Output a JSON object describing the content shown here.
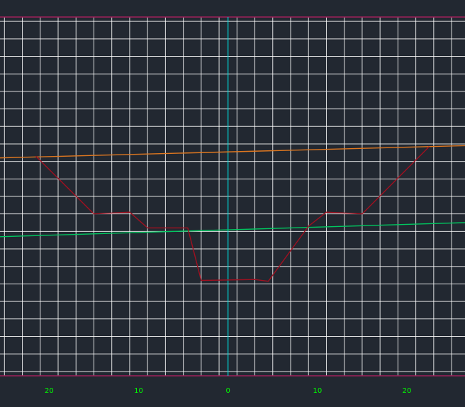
{
  "chart_data": {
    "type": "line",
    "title": "",
    "xlabel": "",
    "ylabel": "",
    "xlim": [
      -25.5,
      26.5
    ],
    "ylim": [
      -8.25,
      12.25
    ],
    "x_ticks": [
      -20,
      -10,
      0,
      10,
      20
    ],
    "x_tick_labels": [
      "20",
      "10",
      "0",
      "10",
      "20"
    ],
    "grid": true,
    "legend": "none",
    "colors": {
      "background": "#222831",
      "grid": "#FFFFFF",
      "border": "#A0205A",
      "center_axis": "#00D8D8",
      "tick_label": "#00FF00"
    },
    "series": [
      {
        "color": "#E07820",
        "x": [
          -25.5,
          26.5
        ],
        "y": [
          4.2,
          4.9
        ]
      },
      {
        "color": "#00C860",
        "x": [
          -25.5,
          26.5
        ],
        "y": [
          -0.3,
          0.5
        ]
      },
      {
        "color": "#A01020",
        "x": [
          -21.5,
          -15,
          -11,
          -9,
          -4.5,
          -3,
          3,
          4.5,
          9,
          11,
          15,
          22.5
        ],
        "y": [
          4.3,
          1.0,
          1.1,
          0.2,
          0.2,
          -2.8,
          -2.75,
          -2.85,
          0.3,
          1.1,
          1.0,
          4.85
        ]
      }
    ]
  }
}
